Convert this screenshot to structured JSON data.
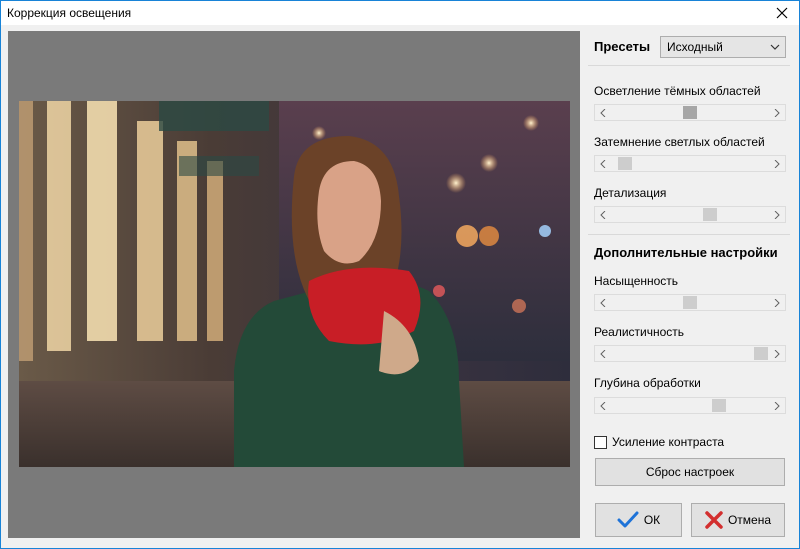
{
  "window": {
    "title": "Коррекция освещения"
  },
  "presets": {
    "label": "Пресеты",
    "selected": "Исходный"
  },
  "sliders": [
    {
      "label": "Осветление тёмных областей",
      "value": 0.5
    },
    {
      "label": "Затемнение светлых областей",
      "value": 0.05
    },
    {
      "label": "Детализация",
      "value": 0.64
    },
    {
      "label": "Насыщенность",
      "value": 0.5
    },
    {
      "label": "Реалистичность",
      "value": 0.99
    },
    {
      "label": "Глубина обработки",
      "value": 0.7
    }
  ],
  "advanced": {
    "title": "Дополнительные настройки"
  },
  "contrast": {
    "label": "Усиление контраста",
    "checked": false
  },
  "buttons": {
    "reset": "Сброс настроек",
    "ok": "ОК",
    "cancel": "Отмена"
  },
  "icons": {
    "close": "close-icon",
    "dropdown": "chevron-down-icon",
    "ok": "checkmark-icon",
    "cancel": "cross-icon"
  },
  "colors": {
    "ok_check": "#1e73d8",
    "cancel_cross": "#d32f2f",
    "accent_border": "#1883d7"
  }
}
